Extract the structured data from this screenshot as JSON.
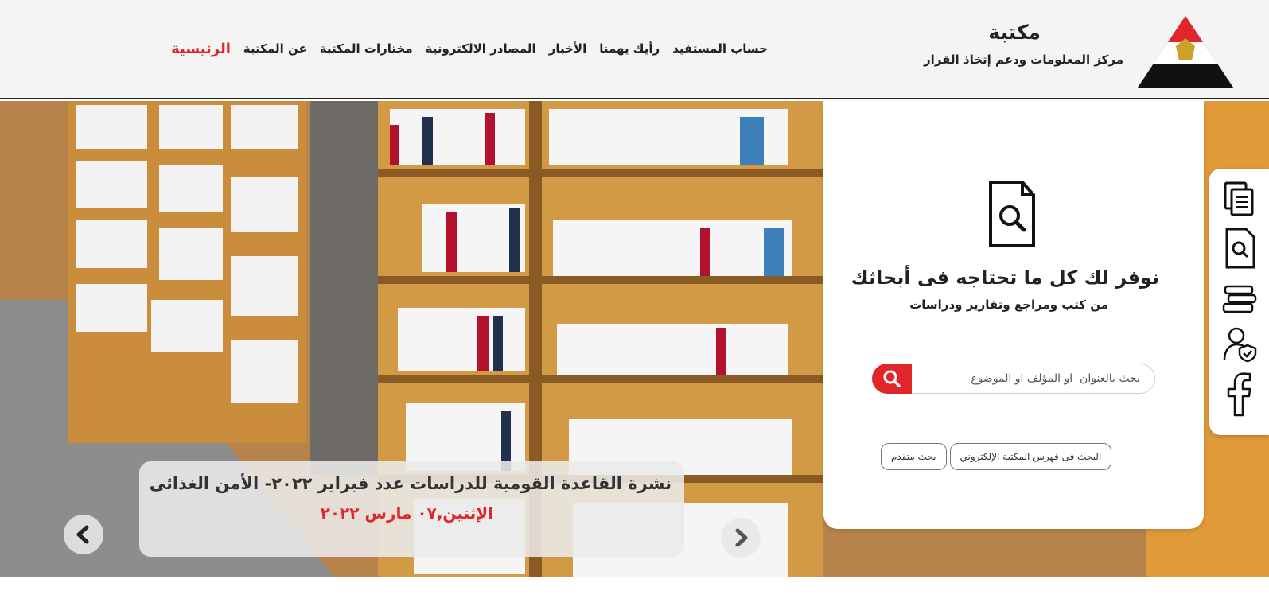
{
  "header": {
    "logo_title": "مكتبة",
    "logo_subtitle": "مركز المعلومات ودعم إتخاذ القرار",
    "nav": [
      {
        "label": "الرئيسية",
        "active": true
      },
      {
        "label": "عن المكتبة"
      },
      {
        "label": "مختارات المكتبة"
      },
      {
        "label": "المصادر الالكترونية"
      },
      {
        "label": "الأخبار"
      },
      {
        "label": "رأيك يهمنا"
      },
      {
        "label": "حساب المستفيد"
      }
    ]
  },
  "search_panel": {
    "heading": "نوفر لك كل ما تحتاجه فى أبحاثك",
    "subheading": "من كتب ومراجع وتقارير ودراسات",
    "search_placeholder": "بحث بالعنوان  او المؤلف او الموضوع",
    "catalog_search_label": "البحث فى فهرس المكتبة الإلكتروني",
    "advanced_search_label": "بحث متقدم"
  },
  "slider": {
    "title": "نشرة القاعدة القومية للدراسات عدد فبراير ٢٠٢٢- الأمن الغذائى",
    "date": "الإثنين,٠٧ مارس ٢٠٢٢"
  },
  "side_icons": [
    "documents-icon",
    "document-search-icon",
    "books-icon",
    "user-shield-icon",
    "facebook-icon"
  ],
  "colors": {
    "accent": "#e0262b",
    "header_bg": "#f4f4f4",
    "text": "#222222"
  }
}
